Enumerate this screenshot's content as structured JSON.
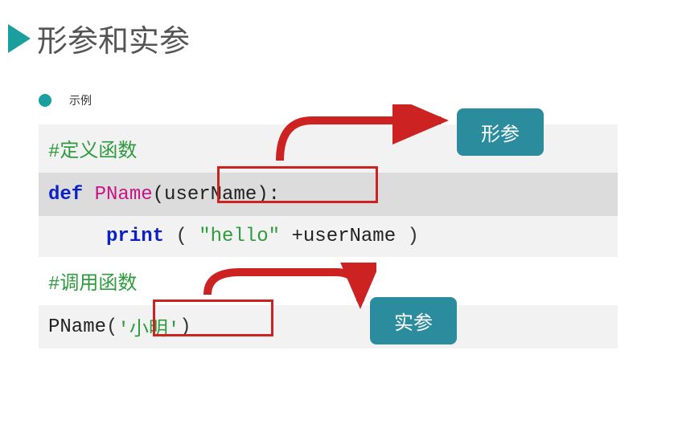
{
  "header": {
    "title": "形参和实参"
  },
  "bullet": {
    "text": "示例"
  },
  "code": {
    "line1": "#定义函数",
    "line2": {
      "def": "def",
      "fn": "PName",
      "param": "(userName)",
      "colon": ":"
    },
    "line3": {
      "indent": "    ",
      "print": "print",
      "lp": "(",
      "str": "\"hello\"",
      "plus": "+userName",
      "rp": ")"
    },
    "line4": "#调用函数",
    "line5": {
      "fn": "PName",
      "lp": "(",
      "arg": "'小明'",
      "rp": ")"
    }
  },
  "labels": {
    "formal": "形参",
    "actual": "实参"
  }
}
